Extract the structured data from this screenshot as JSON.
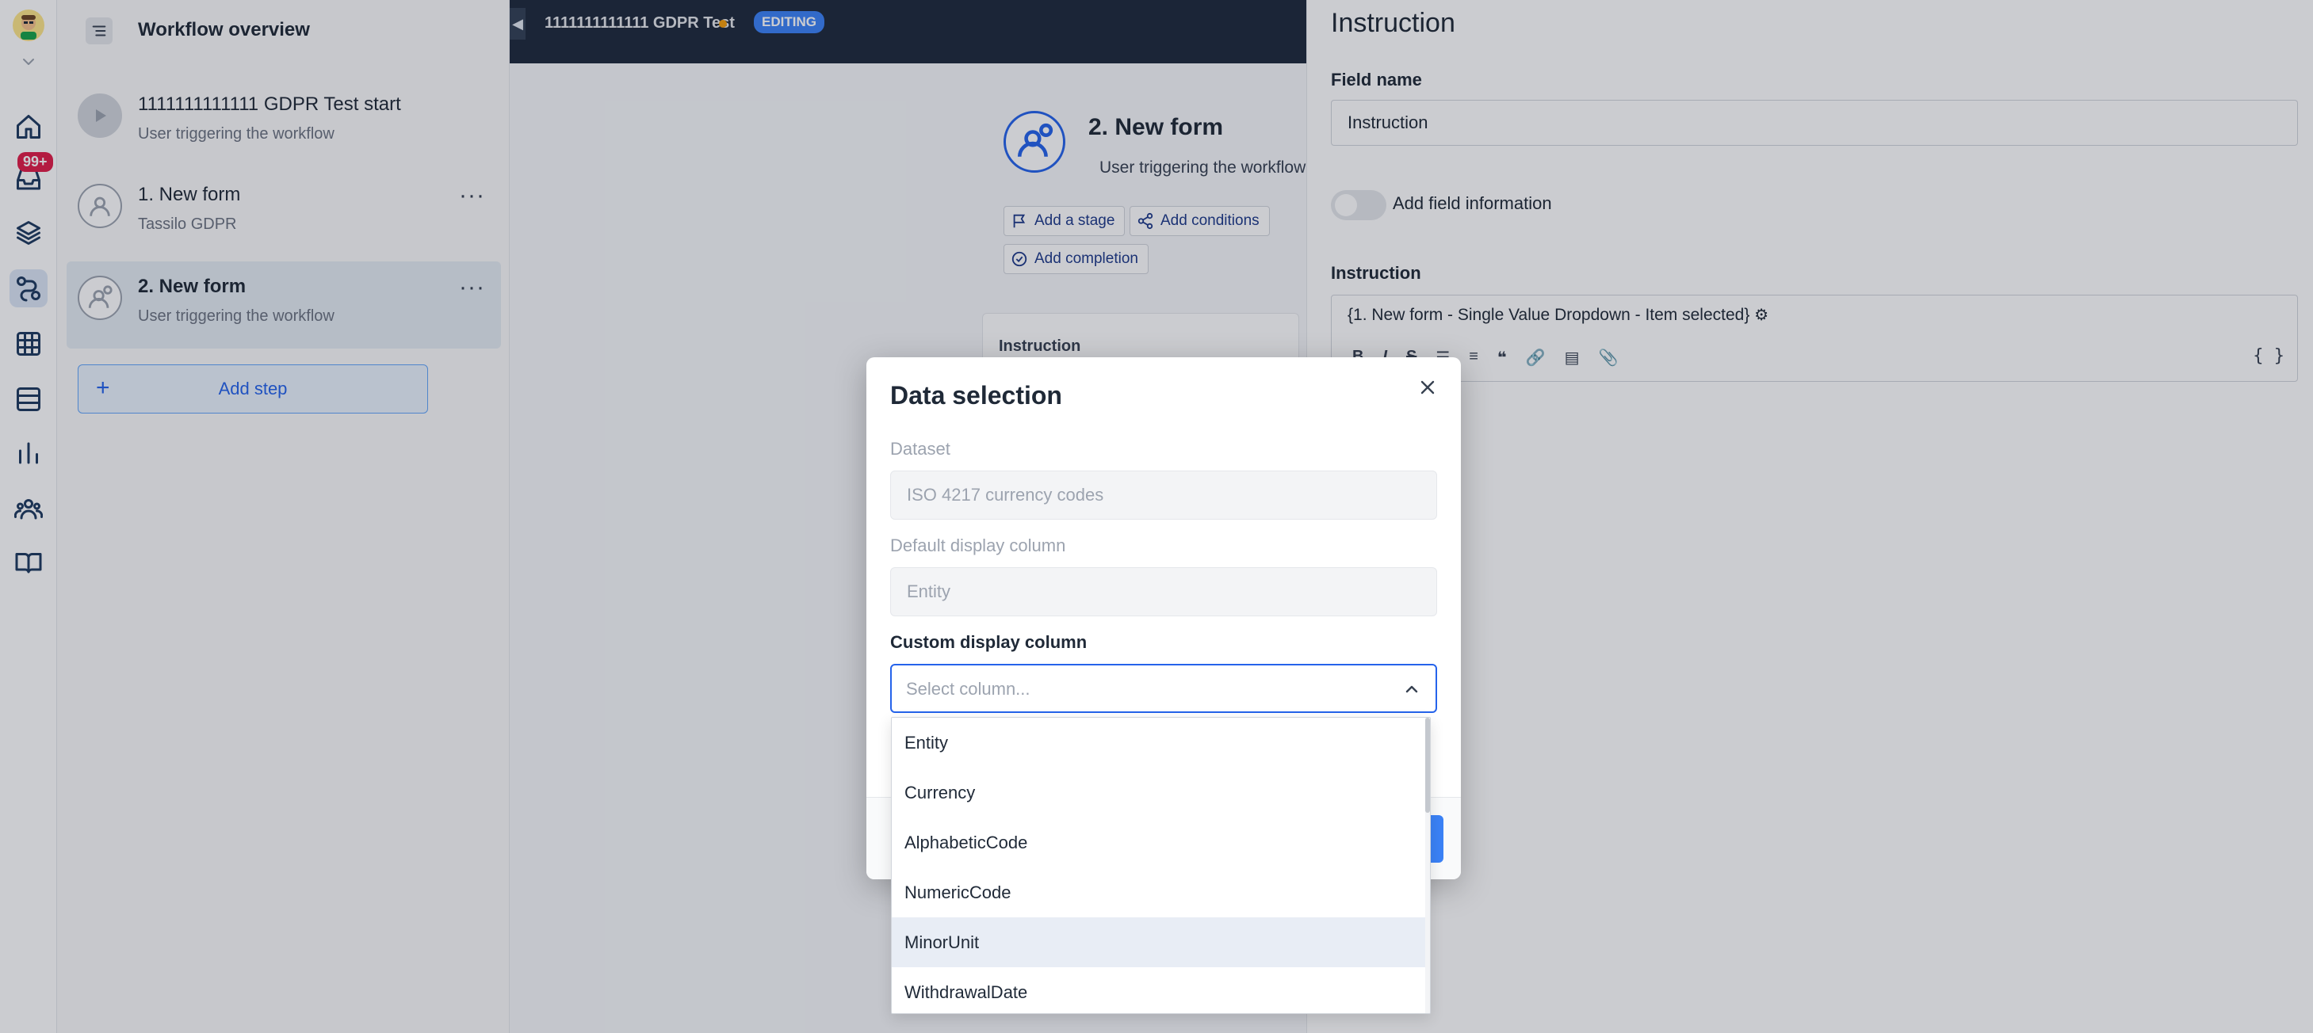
{
  "rail": {
    "notifications_badge": "99+",
    "items": [
      {
        "icon": "home-icon"
      },
      {
        "icon": "inbox-icon"
      },
      {
        "icon": "layers-icon"
      },
      {
        "icon": "workflow-icon"
      },
      {
        "icon": "grid-icon"
      },
      {
        "icon": "list-icon"
      },
      {
        "icon": "chart-icon"
      },
      {
        "icon": "users-icon"
      },
      {
        "icon": "book-icon"
      }
    ]
  },
  "workflow_panel": {
    "title": "Workflow overview",
    "steps": [
      {
        "title": "1111111111111 GDPR Test start",
        "subtitle": "User triggering the workflow"
      },
      {
        "title": "1. New form",
        "subtitle": "Tassilo GDPR"
      },
      {
        "title": "2. New form",
        "subtitle": "User triggering the workflow"
      }
    ],
    "add_step_label": "Add step",
    "more_label": "···"
  },
  "topbar": {
    "workflow_name": "1111111111111 GDPR Test",
    "status_badge": "EDITING",
    "collapse_glyph": "◀"
  },
  "canvas": {
    "node_title": "2. New form",
    "node_subtitle": "User triggering the workflow",
    "actions": [
      "Add a stage",
      "Add conditions",
      "Add completion"
    ],
    "card_label": "Instruction"
  },
  "right_panel": {
    "heading": "Instruction",
    "field_name_label": "Field name",
    "field_name_value": "Instruction",
    "toggle_label": "Add field information",
    "instruction_label": "Instruction",
    "instruction_value": "{1. New form - Single Value Dropdown - Item selected}",
    "toolbar": [
      "B",
      "I",
      "S",
      "☰",
      "≡",
      "❝",
      "🔗",
      "▤",
      "📎"
    ],
    "braces": "{ }"
  },
  "modal": {
    "title": "Data selection",
    "dataset_label": "Dataset",
    "dataset_value": "ISO 4217 currency codes",
    "default_column_label": "Default display column",
    "default_column_value": "Entity",
    "custom_column_label": "Custom display column",
    "custom_column_placeholder": "Select column...",
    "options": [
      "Entity",
      "Currency",
      "AlphabeticCode",
      "NumericCode",
      "MinorUnit",
      "WithdrawalDate"
    ],
    "hovered_option": "MinorUnit"
  },
  "colors": {
    "accent": "#2563eb",
    "topbar": "#1e293b",
    "badge": "#e11d48",
    "status_dot": "#f59e0b"
  }
}
